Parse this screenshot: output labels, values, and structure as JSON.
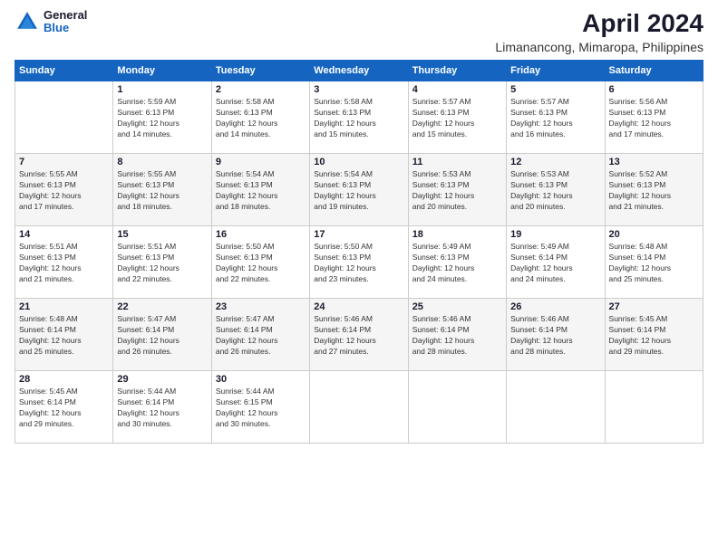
{
  "header": {
    "logo_general": "General",
    "logo_blue": "Blue",
    "title": "April 2024",
    "subtitle": "Limanancong, Mimaropa, Philippines"
  },
  "calendar": {
    "days_of_week": [
      "Sunday",
      "Monday",
      "Tuesday",
      "Wednesday",
      "Thursday",
      "Friday",
      "Saturday"
    ],
    "weeks": [
      [
        {
          "day": "",
          "info": ""
        },
        {
          "day": "1",
          "info": "Sunrise: 5:59 AM\nSunset: 6:13 PM\nDaylight: 12 hours\nand 14 minutes."
        },
        {
          "day": "2",
          "info": "Sunrise: 5:58 AM\nSunset: 6:13 PM\nDaylight: 12 hours\nand 14 minutes."
        },
        {
          "day": "3",
          "info": "Sunrise: 5:58 AM\nSunset: 6:13 PM\nDaylight: 12 hours\nand 15 minutes."
        },
        {
          "day": "4",
          "info": "Sunrise: 5:57 AM\nSunset: 6:13 PM\nDaylight: 12 hours\nand 15 minutes."
        },
        {
          "day": "5",
          "info": "Sunrise: 5:57 AM\nSunset: 6:13 PM\nDaylight: 12 hours\nand 16 minutes."
        },
        {
          "day": "6",
          "info": "Sunrise: 5:56 AM\nSunset: 6:13 PM\nDaylight: 12 hours\nand 17 minutes."
        }
      ],
      [
        {
          "day": "7",
          "info": "Sunrise: 5:55 AM\nSunset: 6:13 PM\nDaylight: 12 hours\nand 17 minutes."
        },
        {
          "day": "8",
          "info": "Sunrise: 5:55 AM\nSunset: 6:13 PM\nDaylight: 12 hours\nand 18 minutes."
        },
        {
          "day": "9",
          "info": "Sunrise: 5:54 AM\nSunset: 6:13 PM\nDaylight: 12 hours\nand 18 minutes."
        },
        {
          "day": "10",
          "info": "Sunrise: 5:54 AM\nSunset: 6:13 PM\nDaylight: 12 hours\nand 19 minutes."
        },
        {
          "day": "11",
          "info": "Sunrise: 5:53 AM\nSunset: 6:13 PM\nDaylight: 12 hours\nand 20 minutes."
        },
        {
          "day": "12",
          "info": "Sunrise: 5:53 AM\nSunset: 6:13 PM\nDaylight: 12 hours\nand 20 minutes."
        },
        {
          "day": "13",
          "info": "Sunrise: 5:52 AM\nSunset: 6:13 PM\nDaylight: 12 hours\nand 21 minutes."
        }
      ],
      [
        {
          "day": "14",
          "info": "Sunrise: 5:51 AM\nSunset: 6:13 PM\nDaylight: 12 hours\nand 21 minutes."
        },
        {
          "day": "15",
          "info": "Sunrise: 5:51 AM\nSunset: 6:13 PM\nDaylight: 12 hours\nand 22 minutes."
        },
        {
          "day": "16",
          "info": "Sunrise: 5:50 AM\nSunset: 6:13 PM\nDaylight: 12 hours\nand 22 minutes."
        },
        {
          "day": "17",
          "info": "Sunrise: 5:50 AM\nSunset: 6:13 PM\nDaylight: 12 hours\nand 23 minutes."
        },
        {
          "day": "18",
          "info": "Sunrise: 5:49 AM\nSunset: 6:13 PM\nDaylight: 12 hours\nand 24 minutes."
        },
        {
          "day": "19",
          "info": "Sunrise: 5:49 AM\nSunset: 6:14 PM\nDaylight: 12 hours\nand 24 minutes."
        },
        {
          "day": "20",
          "info": "Sunrise: 5:48 AM\nSunset: 6:14 PM\nDaylight: 12 hours\nand 25 minutes."
        }
      ],
      [
        {
          "day": "21",
          "info": "Sunrise: 5:48 AM\nSunset: 6:14 PM\nDaylight: 12 hours\nand 25 minutes."
        },
        {
          "day": "22",
          "info": "Sunrise: 5:47 AM\nSunset: 6:14 PM\nDaylight: 12 hours\nand 26 minutes."
        },
        {
          "day": "23",
          "info": "Sunrise: 5:47 AM\nSunset: 6:14 PM\nDaylight: 12 hours\nand 26 minutes."
        },
        {
          "day": "24",
          "info": "Sunrise: 5:46 AM\nSunset: 6:14 PM\nDaylight: 12 hours\nand 27 minutes."
        },
        {
          "day": "25",
          "info": "Sunrise: 5:46 AM\nSunset: 6:14 PM\nDaylight: 12 hours\nand 28 minutes."
        },
        {
          "day": "26",
          "info": "Sunrise: 5:46 AM\nSunset: 6:14 PM\nDaylight: 12 hours\nand 28 minutes."
        },
        {
          "day": "27",
          "info": "Sunrise: 5:45 AM\nSunset: 6:14 PM\nDaylight: 12 hours\nand 29 minutes."
        }
      ],
      [
        {
          "day": "28",
          "info": "Sunrise: 5:45 AM\nSunset: 6:14 PM\nDaylight: 12 hours\nand 29 minutes."
        },
        {
          "day": "29",
          "info": "Sunrise: 5:44 AM\nSunset: 6:14 PM\nDaylight: 12 hours\nand 30 minutes."
        },
        {
          "day": "30",
          "info": "Sunrise: 5:44 AM\nSunset: 6:15 PM\nDaylight: 12 hours\nand 30 minutes."
        },
        {
          "day": "",
          "info": ""
        },
        {
          "day": "",
          "info": ""
        },
        {
          "day": "",
          "info": ""
        },
        {
          "day": "",
          "info": ""
        }
      ]
    ]
  }
}
